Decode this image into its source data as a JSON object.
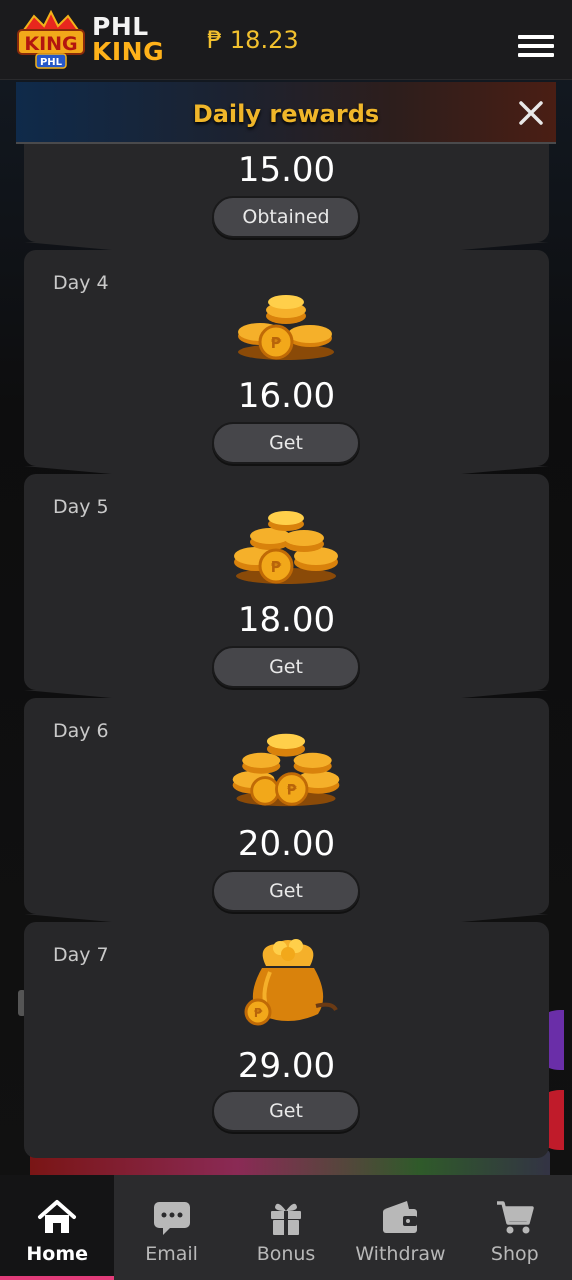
{
  "header": {
    "logo_crest_text": "KING",
    "logo_crest_sub": "PHL",
    "logo_line1": "PHL",
    "logo_line2": "KING",
    "balance": "₱ 18.23"
  },
  "modal": {
    "title": "Daily rewards",
    "rewards": [
      {
        "day": "",
        "amount": "15.00",
        "button": "Obtained",
        "icon": "coin-stack-icon"
      },
      {
        "day": "Day 4",
        "amount": "16.00",
        "button": "Get",
        "icon": "coin-stack-small-icon"
      },
      {
        "day": "Day 5",
        "amount": "18.00",
        "button": "Get",
        "icon": "coin-stack-medium-icon"
      },
      {
        "day": "Day 6",
        "amount": "20.00",
        "button": "Get",
        "icon": "coin-stack-large-icon"
      },
      {
        "day": "Day 7",
        "amount": "29.00",
        "button": "Get",
        "icon": "coin-bag-icon"
      }
    ]
  },
  "nav": [
    {
      "label": "Home",
      "icon": "home-icon",
      "active": true
    },
    {
      "label": "Email",
      "icon": "chat-icon",
      "active": false
    },
    {
      "label": "Bonus",
      "icon": "gift-icon",
      "active": false
    },
    {
      "label": "Withdraw",
      "icon": "wallet-icon",
      "active": false
    },
    {
      "label": "Shop",
      "icon": "cart-icon",
      "active": false
    }
  ],
  "colors": {
    "accent": "#f0b62a",
    "active_nav": "#e23d7a",
    "card_bg": "#272729"
  }
}
